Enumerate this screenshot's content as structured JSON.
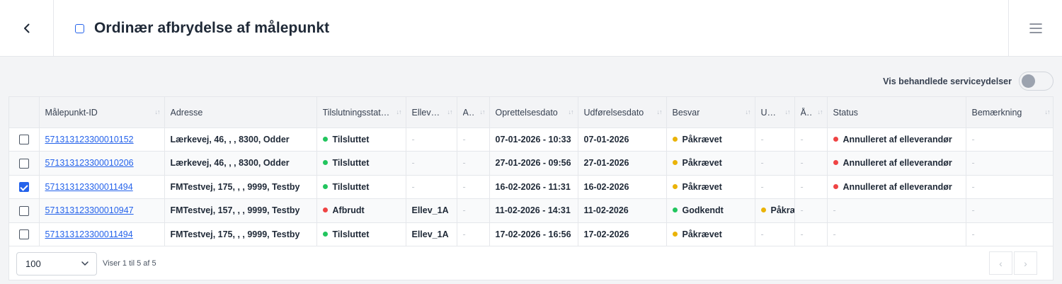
{
  "header": {
    "title": "Ordinær afbrydelse af målepunkt"
  },
  "toggle": {
    "label": "Vis behandlede serviceydelser",
    "on": false
  },
  "table": {
    "columns": [
      "Målepunkt-ID",
      "Adresse",
      "Tilslutningsstatus",
      "Ellever…",
      "A…",
      "Oprettelsesdato",
      "Udførelsesdato",
      "Besvar",
      "Ud…",
      "Å…",
      "Status",
      "Bemærkning"
    ],
    "rows": [
      {
        "checked": false,
        "id": "571313123300010152",
        "address": "Lærkevej, 46, , , 8300, Odder",
        "conn": "Tilsluttet",
        "conn_color": "#22c55e",
        "elev": "-",
        "a": "-",
        "created": "07-01-2026 - 10:33",
        "done": "07-01-2026",
        "besvar": "Påkrævet",
        "besvar_color": "#eab308",
        "ud": "-",
        "aa": "-",
        "status": "Annulleret af elleverandør",
        "status_color": "#ef4444",
        "note": "-"
      },
      {
        "checked": false,
        "id": "571313123300010206",
        "address": "Lærkevej, 46, , , 8300, Odder",
        "conn": "Tilsluttet",
        "conn_color": "#22c55e",
        "elev": "-",
        "a": "-",
        "created": "27-01-2026 - 09:56",
        "done": "27-01-2026",
        "besvar": "Påkrævet",
        "besvar_color": "#eab308",
        "ud": "-",
        "aa": "-",
        "status": "Annulleret af elleverandør",
        "status_color": "#ef4444",
        "note": "-"
      },
      {
        "checked": true,
        "id": "571313123300011494",
        "address": "FMTestvej, 175, , , 9999, Testby",
        "conn": "Tilsluttet",
        "conn_color": "#22c55e",
        "elev": "-",
        "a": "-",
        "created": "16-02-2026 - 11:31",
        "done": "16-02-2026",
        "besvar": "Påkrævet",
        "besvar_color": "#eab308",
        "ud": "-",
        "aa": "-",
        "status": "Annulleret af elleverandør",
        "status_color": "#ef4444",
        "note": "-"
      },
      {
        "checked": false,
        "id": "571313123300010947",
        "address": "FMTestvej, 157, , , 9999, Testby",
        "conn": "Afbrudt",
        "conn_color": "#ef4444",
        "elev": "Ellev_1A",
        "a": "-",
        "created": "11-02-2026 - 14:31",
        "done": "11-02-2026",
        "besvar": "Godkendt",
        "besvar_color": "#22c55e",
        "ud": "Påkræ",
        "ud_color": "#eab308",
        "aa": "-",
        "status": "-",
        "note": "-"
      },
      {
        "checked": false,
        "id": "571313123300011494",
        "address": "FMTestvej, 175, , , 9999, Testby",
        "conn": "Tilsluttet",
        "conn_color": "#22c55e",
        "elev": "Ellev_1A",
        "a": "-",
        "created": "17-02-2026 - 16:56",
        "done": "17-02-2026",
        "besvar": "Påkrævet",
        "besvar_color": "#eab308",
        "ud": "-",
        "aa": "-",
        "status": "-",
        "note": "-"
      }
    ]
  },
  "footer": {
    "page_size": "100",
    "rows_info": "Viser 1 til 5 af 5"
  }
}
